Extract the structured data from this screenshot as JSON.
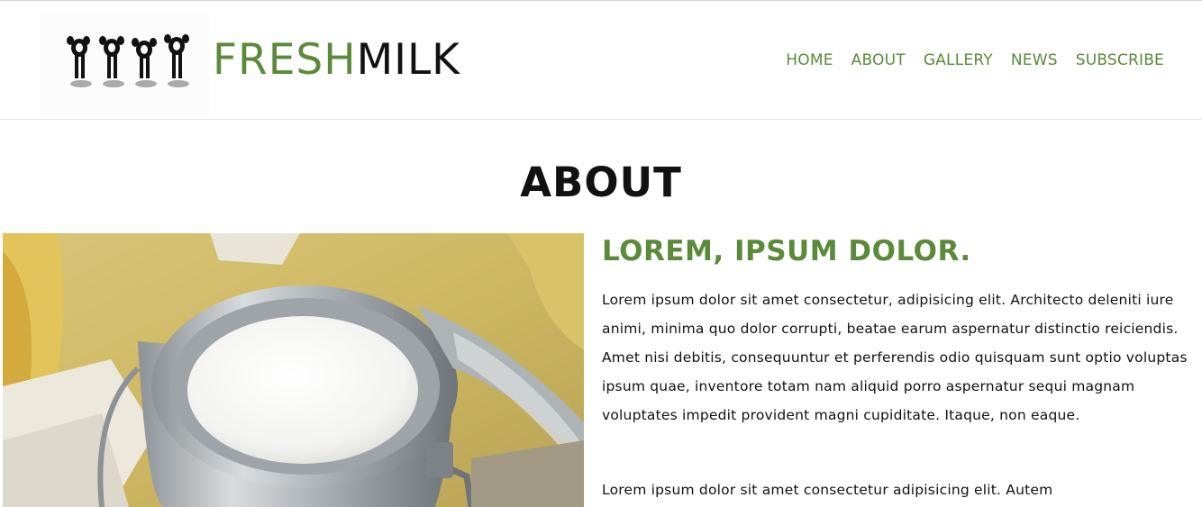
{
  "header": {
    "brand": {
      "part1": "FRESH",
      "part2": "MILK"
    },
    "nav": [
      "HOME",
      "ABOUT",
      "GALLERY",
      "NEWS",
      "SUBSCRIBE"
    ]
  },
  "about": {
    "title": "ABOUT",
    "heading": "LOREM, IPSUM DOLOR.",
    "paragraphs": [
      "Lorem ipsum dolor sit amet consectetur, adipisicing elit. Architecto deleniti iure animi, minima quo dolor corrupti, beatae earum aspernatur distinctio reiciendis. Amet nisi debitis, consequuntur et perferendis odio quisquam sunt optio voluptas ipsum quae, inventore totam nam aliquid porro aspernatur sequi magnam voluptates impedit provident magni cupiditate. Itaque, non eaque.",
      "Lorem ipsum dolor sit amet consectetur adipisicing elit. Autem"
    ]
  },
  "colors": {
    "accent": "#5b8a3a",
    "text": "#111111"
  },
  "icons": {
    "logo": "cows-logo-icon"
  }
}
